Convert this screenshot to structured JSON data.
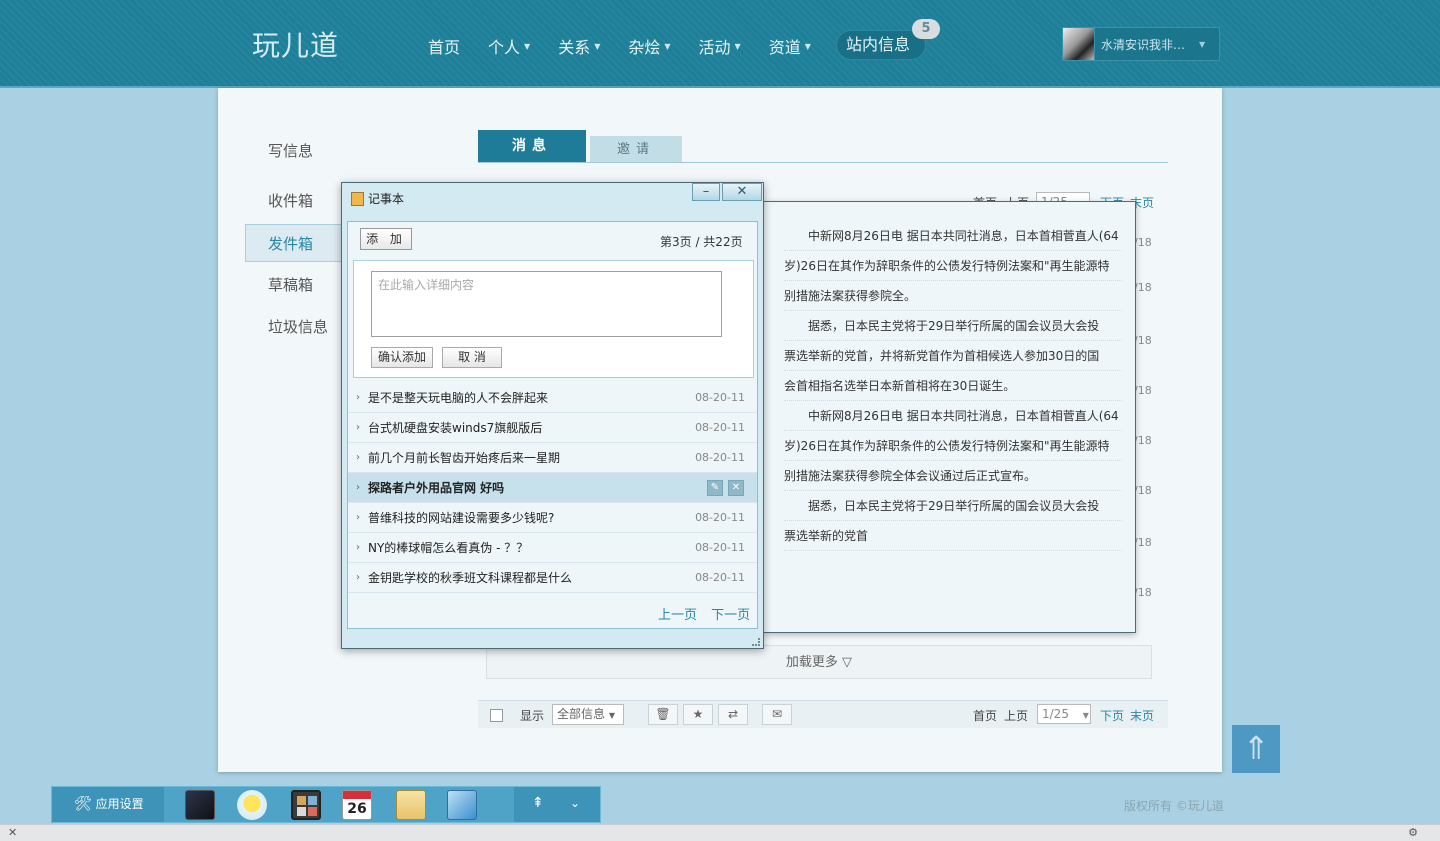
{
  "header": {
    "logo": "玩儿道",
    "nav": [
      "首页",
      "个人",
      "关系",
      "杂烩",
      "活动",
      "资道"
    ],
    "messages_label": "站内信息",
    "messages_count": "5",
    "user_name": "水清安识我非…"
  },
  "sidebar": {
    "items": [
      {
        "label": "写信息"
      },
      {
        "label": "收件箱"
      },
      {
        "label": "发件箱"
      },
      {
        "label": "草稿箱"
      },
      {
        "label": "垃圾信息"
      }
    ],
    "active": "发件箱"
  },
  "tabs": [
    {
      "label": "消息",
      "active": true
    },
    {
      "label": "邀请",
      "active": false
    }
  ],
  "pagination": {
    "first": "首页",
    "prev": "上页",
    "next": "下页",
    "last": "末页",
    "page": "1/25"
  },
  "message_dates": [
    "/18",
    "/18",
    "/18",
    "/18",
    "/18",
    "/18",
    "/18",
    "/18"
  ],
  "load_more": "加载更多 ▽",
  "bottom_bar": {
    "show_label": "显示",
    "filter": "全部信息"
  },
  "notepad": {
    "title": "记事本",
    "add_button": "添 加",
    "page_info": "第3页 / 共22页",
    "textarea_placeholder": "在此输入详细内容",
    "confirm_button": "确认添加",
    "cancel_button": "取 消",
    "notes": [
      {
        "title": "是不是整天玩电脑的人不会胖起来",
        "date": "08-20-11"
      },
      {
        "title": "台式机硬盘安装winds7旗舰版后",
        "date": "08-20-11"
      },
      {
        "title": "前几个月前长智齿开始疼后来一星期",
        "date": "08-20-11"
      },
      {
        "title": "探路者户外用品官网 好吗",
        "date": ""
      },
      {
        "title": "普维科技的网站建设需要多少钱呢?",
        "date": "08-20-11"
      },
      {
        "title": "NY的棒球帽怎么看真伪 - ？？",
        "date": "08-20-11"
      },
      {
        "title": "金钥匙学校的秋季班文科课程都是什么",
        "date": "08-20-11"
      }
    ],
    "prev_page": "上一页",
    "next_page": "下一页"
  },
  "reader": {
    "lines": [
      "　　中新网8月26日电 据日本共同社消息，日本首相菅直人(64",
      "岁)26日在其作为辞职条件的公债发行特例法案和\"再生能源特",
      "别措施法案获得参院全。",
      "　　据悉，日本民主党将于29日举行所属的国会议员大会投",
      "票选举新的党首，并将新党首作为首相候选人参加30日的国",
      "会首相指名选举日本新首相将在30日诞生。",
      "　　中新网8月26日电 据日本共同社消息，日本首相菅直人(64",
      "岁)26日在其作为辞职条件的公债发行特例法案和\"再生能源特",
      "别措施法案获得参院全体会议通过后正式宣布。",
      "　　据悉，日本民主党将于29日举行所属的国会议员大会投",
      "票选举新的党首"
    ]
  },
  "dock": {
    "settings_label": "应用设置",
    "apps": [
      "contacts-icon",
      "weather-icon",
      "calculator-icon",
      "calendar-icon",
      "notepad-icon",
      "folder-icon"
    ],
    "calendar_day": "26"
  },
  "footer": {
    "copyright": "版权所有 ©玩儿道"
  },
  "colors": {
    "header": "#1e7f99",
    "accent": "#2a86a8",
    "background": "#a9d1e3"
  }
}
